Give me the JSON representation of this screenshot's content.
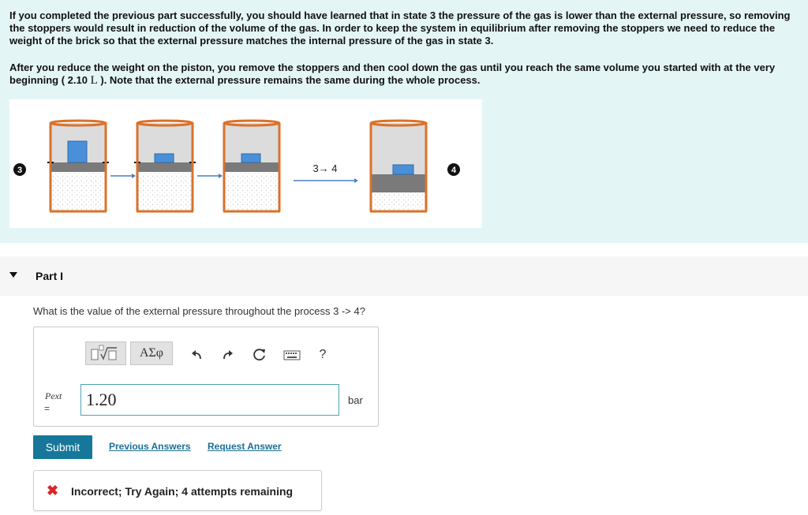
{
  "intro": {
    "paragraph1": "If you completed the previous part successfully, you should have learned that in state 3 the pressure of the gas is lower than the external pressure, so removing the stoppers would result in reduction of the volume of the gas. In order to keep the system in equilibrium after removing the stoppers we need to reduce the weight of the  brick so that the external pressure matches the internal pressure of the gas in state 3.",
    "paragraph2_before": "After you reduce the weight on the piston, you remove the stoppers and then cool down the gas until you reach the same volume you started with at the very beginning ( 2.10 ",
    "paragraph2_unit": "L",
    "paragraph2_after": "  ). Note that the external pressure remains the same during the whole process."
  },
  "figure": {
    "state_start": "3",
    "state_end": "4",
    "transition_label": "3→ 4",
    "colors": {
      "cylinder_rim": "#d9722a",
      "cylinder_fill": "#dcdcdc",
      "piston": "#7a7a7a",
      "brick": "#4a90d9",
      "arrow": "#4a7fc1"
    }
  },
  "part": {
    "title": "Part I",
    "question": "What is the value of the external pressure throughout the process 3 -> 4?"
  },
  "toolbar": {
    "templates_icon": "templates-icon",
    "greek_label": "ΑΣφ",
    "undo_icon": "undo-icon",
    "redo_icon": "redo-icon",
    "reset_icon": "reset-icon",
    "keyboard_icon": "keyboard-icon",
    "help_label": "?"
  },
  "answer": {
    "variable": "Pext",
    "equals": "=",
    "value": "1.20",
    "unit": "bar"
  },
  "actions": {
    "submit": "Submit",
    "previous_answers": "Previous Answers",
    "request_answer": "Request Answer"
  },
  "feedback": {
    "icon": "x-icon",
    "text": "Incorrect; Try Again; 4 attempts remaining",
    "color": "#d8262a"
  }
}
